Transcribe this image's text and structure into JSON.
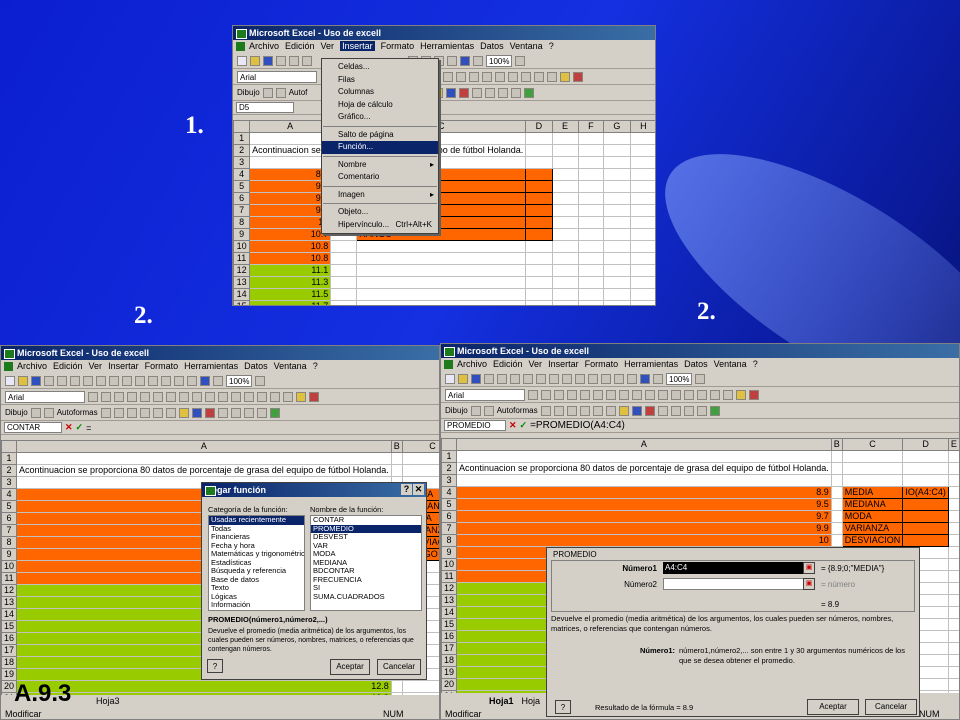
{
  "slide": {
    "step1": "1.",
    "step2_left": "2.",
    "step2_right": "2.",
    "code": "A.9.3"
  },
  "app": {
    "title": "Microsoft Excel - Uso de excell",
    "menu": [
      "Archivo",
      "Edición",
      "Ver",
      "Insertar",
      "Formato",
      "Herramientas",
      "Datos",
      "Ventana",
      "?"
    ],
    "font_name": "Arial",
    "zoom": "100%",
    "draw_label": "Dibujo",
    "autoshapes": "Autoformas",
    "columns": [
      "A",
      "B",
      "C",
      "D",
      "E",
      "F",
      "G",
      "H",
      "I"
    ],
    "intro_text": "Acontinuacion se proporciona 80 datos de porcentaje de grasa del equipo de fútbol Holanda.",
    "data_orange": [
      "8.9",
      "9.5",
      "9.7",
      "9.9",
      "10",
      "10.7",
      "10.8",
      "10.8"
    ],
    "data_green": [
      "11.1",
      "11.3",
      "11.5",
      "11.7",
      "12.1",
      "12.1",
      "12.7",
      "12.7",
      "12.8",
      "12.8"
    ],
    "stat_labels": [
      "MEDIA",
      "MEDIANA",
      "MODA",
      "VARIANZA",
      "DESVIACION",
      "RANGO"
    ],
    "status": "Modificar",
    "num_indicator": "NUM",
    "sheet_tab": "Hoja1",
    "sheet_tab3": "Hoja3",
    "sheet_tab2": "Hoja"
  },
  "win1": {
    "namebox": "D5",
    "partial_intro": "Acontinuacion se p",
    "partial_intro_tail": "je de grasa del equipo de fútbol Holanda.",
    "toolbar_font": "Arial",
    "draw": "Dibujo",
    "auto": "Autof",
    "insert_menu": {
      "items": [
        "Celdas...",
        "Filas",
        "Columnas",
        "Hoja de cálculo",
        "Gráfico...",
        "Salto de página",
        "Función...",
        "Nombre",
        "Comentario",
        "Imagen",
        "Objeto...",
        "Hipervínculo..."
      ],
      "shortcut": "Ctrl+Alt+K"
    }
  },
  "win2": {
    "namebox": "CONTAR",
    "formula": "=",
    "media_formula": "=",
    "dialog": {
      "title": "Pegar función",
      "cat_label": "Categoría de la función:",
      "name_label": "Nombre de la función:",
      "categories": [
        "Usadas recientemente",
        "Todas",
        "Financieras",
        "Fecha y hora",
        "Matemáticas y trigonométricas",
        "Estadísticas",
        "Búsqueda y referencia",
        "Base de datos",
        "Texto",
        "Lógicas",
        "Información"
      ],
      "functions": [
        "CONTAR",
        "PROMEDIO",
        "DESVEST",
        "VAR",
        "MODA",
        "MEDIANA",
        "BDCONTAR",
        "FRECUENCIA",
        "SI",
        "SUMA.CUADRADOS"
      ],
      "syntax": "PROMEDIO(número1,número2,...)",
      "description": "Devuelve el promedio (media aritmética) de los argumentos, los cuales pueden ser números, nombres, matrices, o referencias que contengan números.",
      "ok": "Aceptar",
      "cancel": "Cancelar"
    }
  },
  "win3": {
    "namebox": "PROMEDIO",
    "formula": "=PROMEDIO(A4:C4)",
    "cell_d4": "IO(A4:C4)",
    "dialog": {
      "title": "PROMEDIO",
      "arg1_label": "Número1",
      "arg1_value": "A4:C4",
      "arg1_result": "= {8.9;0;\"MEDIA\"}",
      "arg2_label": "Número2",
      "arg2_result": "= número",
      "total": "= 8.9",
      "description": "Devuelve el promedio (media aritmética) de los argumentos, los cuales pueden ser números, nombres, matrices, o referencias que contengan números.",
      "arg_help_label": "Número1:",
      "arg_help": "número1,número2,... son entre 1 y 30 argumentos numéricos de los que se desea obtener el promedio.",
      "result_label": "Resultado de la fórmula = 8.9",
      "ok": "Aceptar",
      "cancel": "Cancelar"
    }
  }
}
